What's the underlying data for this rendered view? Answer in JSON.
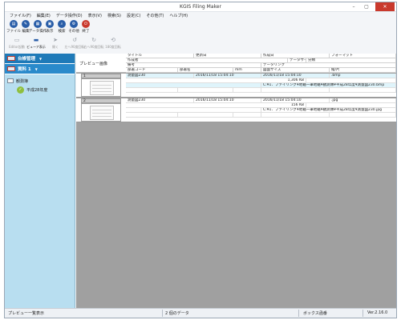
{
  "window": {
    "title": "KGIS Filing Maker",
    "controls": {
      "minimize": "–",
      "maximize": "▢",
      "close": "✕"
    }
  },
  "menu": [
    "ファイル(F)",
    "編集(E)",
    "データ操作(D)",
    "表示(V)",
    "検索(S)",
    "設定(C)",
    "その他(T)",
    "ヘルプ(H)"
  ],
  "toolbar_main": [
    {
      "label": "ファイル",
      "icon": "file-icon",
      "color": "#2a5ea8"
    },
    {
      "label": "編集",
      "icon": "edit-icon",
      "color": "#2a5ea8"
    },
    {
      "label": "データ操作",
      "icon": "data-icon",
      "color": "#2a5ea8"
    },
    {
      "label": "表示",
      "icon": "view-icon",
      "color": "#2a5ea8"
    },
    {
      "label": "検索",
      "icon": "search-icon",
      "color": "#2a5ea8"
    },
    {
      "label": "その他",
      "icon": "other-icon",
      "color": "#2a5ea8"
    },
    {
      "label": "終了",
      "icon": "exit-icon",
      "color": "#c9392d"
    }
  ],
  "toolbar_view": [
    {
      "label": "Editor起動",
      "icon": "editor-icon",
      "active": false
    },
    {
      "label": "ビューア表示",
      "icon": "viewer-icon",
      "active": true
    },
    {
      "label": "開く",
      "icon": "open-icon",
      "active": false
    },
    {
      "label": "左へ90度回転",
      "icon": "rotate-left-icon",
      "active": false
    },
    {
      "label": "右へ90度回転",
      "icon": "rotate-right-icon",
      "active": false
    },
    {
      "label": "180度回転",
      "icon": "rotate-180-icon",
      "active": false
    }
  ],
  "sidebar": {
    "header1": "台帳管理",
    "header2": "資料 1",
    "tree_root": "観測簿",
    "tree_child": "平成28年度"
  },
  "grid": {
    "preview_label": "プレビュー画像",
    "headers": {
      "title": "タイトル",
      "updated": "更新日",
      "created": "作成日",
      "format": "フォーマット",
      "author": "作成者",
      "data_size": "データサイズ",
      "category": "分類",
      "note": "備考",
      "data_link": "データリンク",
      "dept_code": "部署コード",
      "dept_name": "部署名",
      "mm": "mm",
      "figure_size": "図面サイズ",
      "orientation": "縦/片"
    }
  },
  "records": [
    {
      "num": "1",
      "title": "測量図230",
      "updated": "2016/11/18 15:04:10",
      "created": "2016/11/18 15:04:10",
      "format": ".bmp",
      "size": "1,306 KB",
      "link": "C:¥1．ファイリング¥地籍一筆地籍¥観測簿¥平成28年度¥測量図230.bmp"
    },
    {
      "num": "2",
      "title": "測量図230",
      "updated": "2016/11/18 15:04:10",
      "created": "2016/11/18 15:04:10",
      "format": ".jpg",
      "size": "156 KB",
      "link": "C:¥1．ファイリング¥地籍一筆地籍¥観測簿¥平成28年度¥測量図230.jpg"
    }
  ],
  "status": {
    "mode": "プレビュー一覧表示",
    "count": "2 個のデータ",
    "box": "ボックス函番",
    "version": "Ver.2.16.0"
  },
  "colors": {
    "sidebar_bg": "#b8def0",
    "sidebar_header": "#1f7ab8",
    "main_bg": "#a0a0a0",
    "row_highlight": "#dff4fb"
  }
}
